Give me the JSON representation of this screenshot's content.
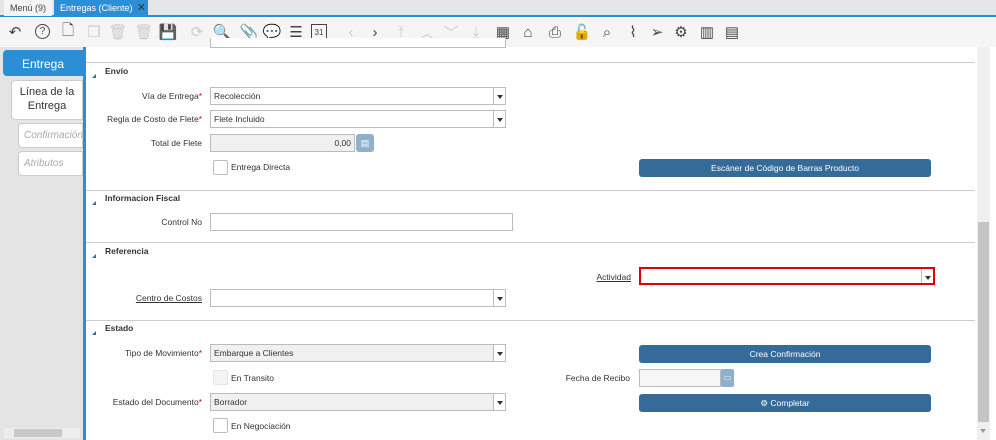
{
  "tabs": [
    {
      "label": "Menú (9)"
    },
    {
      "label": "Entregas (Cliente)"
    }
  ],
  "toolbar": {
    "icons": [
      "undo-icon",
      "help-icon",
      "new-record-icon",
      "copy-icon",
      "delete-icon",
      "delete-selection-icon",
      "save-icon",
      "refresh-icon",
      "search-icon",
      "attachment-icon",
      "chat-icon",
      "grid-toggle-icon",
      "calendar-icon",
      "previous-icon",
      "next-icon",
      "first-record-icon",
      "parent-record-icon",
      "detail-record-icon",
      "last-record-icon",
      "report-icon",
      "archive-icon",
      "print-icon",
      "lock-icon",
      "zoom-across-icon",
      "workflow-icon",
      "send-icon",
      "process-gear-icon",
      "barcode-scan-icon",
      "export-icon"
    ],
    "calendar_day": "31"
  },
  "left_tabs": [
    {
      "label": "Entrega"
    },
    {
      "label": "Línea de la Entrega"
    },
    {
      "label": "Confirmación"
    },
    {
      "label": "Atributos"
    }
  ],
  "envio": {
    "title": "Envío",
    "via_label": "Vía de Entrega",
    "via_value": "Recolección",
    "regla_label": "Regla de Costo de Flete",
    "regla_value": "Flete Incluido",
    "total_label": "Total de Flete",
    "total_value": "0,00",
    "directa_label": "Entrega Directa",
    "scanner_button": "Escáner de Código de Barras Producto"
  },
  "fiscal": {
    "title": "Informacion Fiscal",
    "control_label": "Control No",
    "control_value": ""
  },
  "referencia": {
    "title": "Referencia",
    "actividad_label": "Actividad",
    "actividad_value": "",
    "centro_label": "Centro de Costos",
    "centro_value": ""
  },
  "estado": {
    "title": "Estado",
    "tipo_label": "Tipo de Movimiento",
    "tipo_value": "Embarque a Clientes",
    "crea_button": "Crea Confirmación",
    "transito_label": "En Transito",
    "fecha_label": "Fecha de Recibo",
    "fecha_value": "",
    "doc_label": "Estado del Documento",
    "doc_value": "Borrador",
    "completar_button": "Completar",
    "negociacion_label": "En Negociación"
  },
  "colors": {
    "accent": "#2c8fd6",
    "button": "#346b98",
    "required": "#dd0000",
    "error_border": "#e00000"
  }
}
